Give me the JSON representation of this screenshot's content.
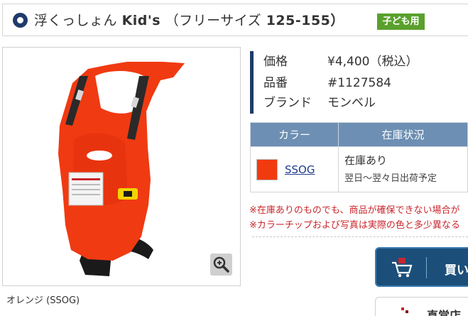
{
  "title": {
    "name": "浮くっしょん",
    "kids": "Kid's",
    "size": "（フリーサイズ",
    "range": "125-155）",
    "badge": "子ども用"
  },
  "product_image": {
    "caption": "オレンジ (SSOG)",
    "zoom_icon": "zoom-in-icon"
  },
  "specs": [
    {
      "label": "価格",
      "value": "¥4,400（税込）"
    },
    {
      "label": "品番",
      "value": "#1127584"
    },
    {
      "label": "ブランド",
      "value": "モンベル"
    }
  ],
  "stock_table": {
    "headers": [
      "カラー",
      "在庫状況"
    ],
    "rows": [
      {
        "color_code": "SSOG",
        "swatch": "#f23a0f",
        "status": "在庫あり",
        "shipping": "翌日〜翌々日出荷予定"
      }
    ]
  },
  "notices": [
    "※在庫ありのものでも、商品が確保できない場合が",
    "※カラーチップおよび写真は実際の色と多少異なる"
  ],
  "cart_button": {
    "label": "買い",
    "icon": "cart-icon"
  },
  "store_button": {
    "label": "直営店",
    "icon": "store-icon"
  },
  "colors": {
    "navy": "#1f3b6a",
    "header_blue": "#6d8fb3",
    "notice_red": "#c8262c",
    "badge_green": "#5aa02c"
  }
}
